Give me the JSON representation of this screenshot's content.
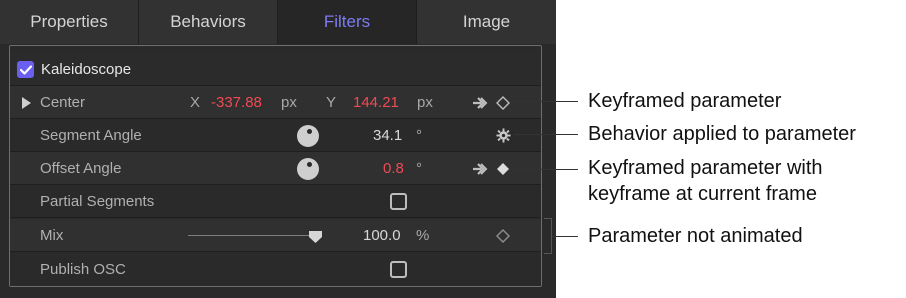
{
  "tabs": [
    {
      "label": "Properties",
      "active": false
    },
    {
      "label": "Behaviors",
      "active": false
    },
    {
      "label": "Filters",
      "active": true
    },
    {
      "label": "Image",
      "active": false
    }
  ],
  "filter": {
    "name": "Kaleidoscope",
    "enabled": true
  },
  "params": {
    "center": {
      "label": "Center",
      "x_axis": "X",
      "x_value": "-337.88",
      "x_unit": "px",
      "y_axis": "Y",
      "y_value": "144.21",
      "y_unit": "px"
    },
    "segment_angle": {
      "label": "Segment Angle",
      "value": "34.1",
      "unit": "°"
    },
    "offset_angle": {
      "label": "Offset Angle",
      "value": "0.8",
      "unit": "°"
    },
    "partial_segments": {
      "label": "Partial Segments",
      "checked": false
    },
    "mix": {
      "label": "Mix",
      "value": "100.0",
      "unit": "%",
      "level": 1.0
    },
    "publish_osc": {
      "label": "Publish OSC",
      "checked": false
    }
  },
  "callouts": {
    "keyframed": "Keyframed parameter",
    "behavior": "Behavior applied to parameter",
    "keyframe_current_line1": "Keyframed parameter with",
    "keyframe_current_line2": "keyframe at current frame",
    "not_animated": "Parameter not animated"
  },
  "colors": {
    "accent": "#7c7cf2",
    "checkbox": "#6b5ff0",
    "keyframed_value": "#f04a55"
  }
}
